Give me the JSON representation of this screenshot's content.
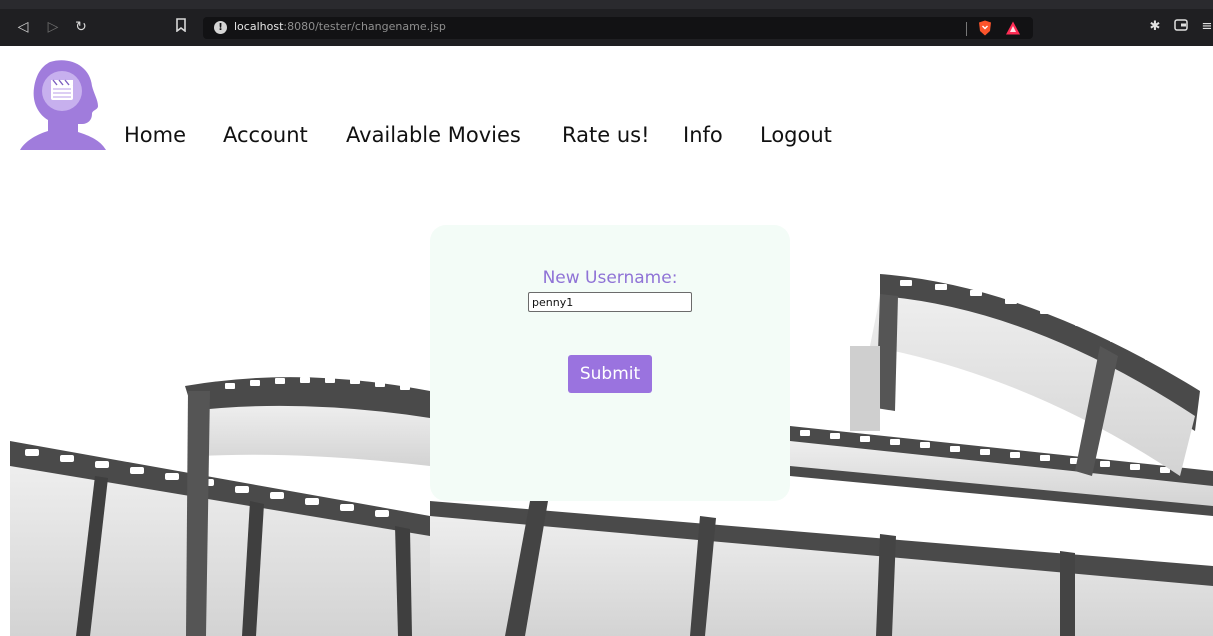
{
  "browser": {
    "url_host": "localhost",
    "url_rest": ":8080/tester/changename.jsp",
    "back_icon": "back-arrow-icon",
    "forward_icon": "forward-arrow-icon",
    "reload_icon": "reload-icon",
    "bookmark_icon": "bookmark-icon",
    "site_info_icon": "info-icon",
    "shield_color": "#fb542b",
    "rewards_color": "#ff2d55"
  },
  "nav": {
    "items": [
      {
        "label": "Home"
      },
      {
        "label": "Account"
      },
      {
        "label": "Available Movies"
      },
      {
        "label": "Rate us!"
      },
      {
        "label": "Info"
      },
      {
        "label": "Logout"
      }
    ]
  },
  "form": {
    "label": "New Username:",
    "username_value": "penny1",
    "submit_label": "Submit"
  },
  "colors": {
    "accent": "#9a73df",
    "label_color": "#8f73d6",
    "card_background": "#f3fcf7",
    "logo_purple": "#a07cdc"
  }
}
